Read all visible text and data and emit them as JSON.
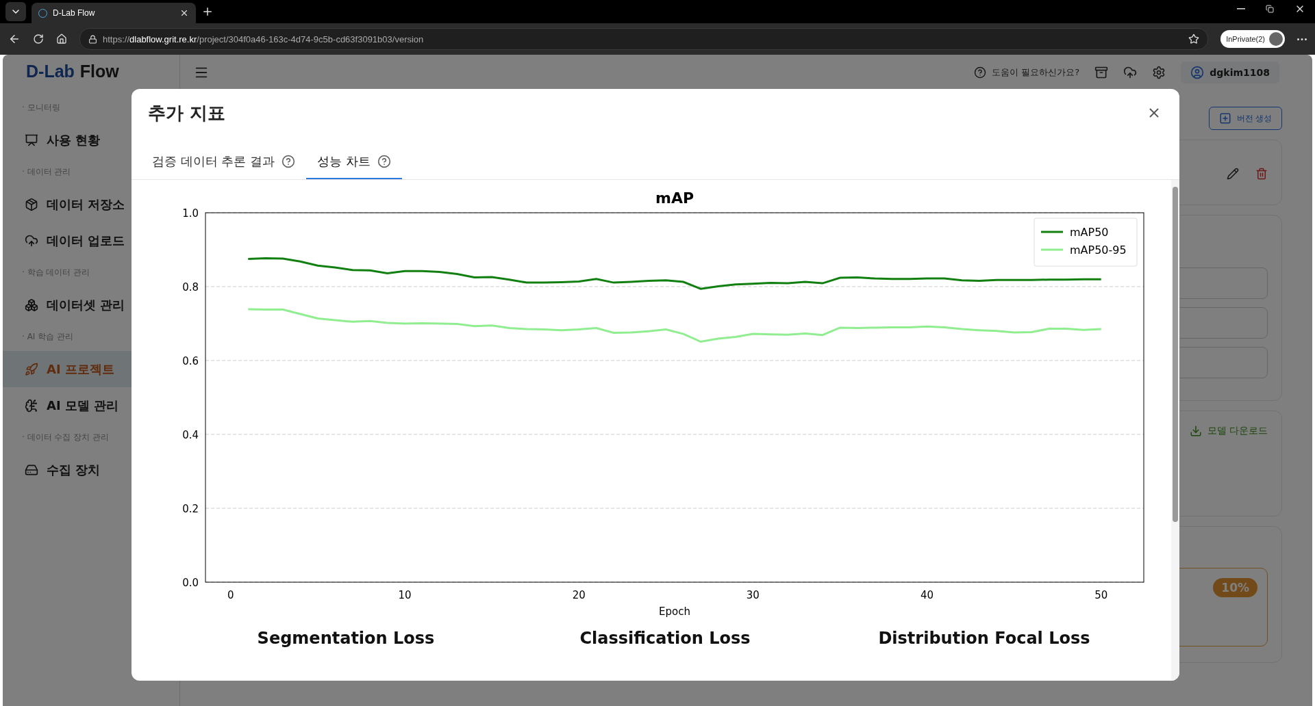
{
  "browser": {
    "tab_title": "D-Lab Flow",
    "url_scheme": "https://",
    "url_host": "dlabflow.grit.re.kr",
    "url_path": "/project/304f0a46-163c-4d74-9c5b-cd63f3091b03/version",
    "profile": "InPrivate(2)"
  },
  "app": {
    "logo_part1": "D-Lab",
    "logo_part2": "Flow",
    "help": "도움이 필요하신가요?",
    "user": "dgkim1108"
  },
  "sidebar": [
    {
      "label": "· 모니터링",
      "items": [
        {
          "label": "사용 현황",
          "selected": false
        }
      ]
    },
    {
      "label": "· 데이터 관리",
      "items": [
        {
          "label": "데이터 저장소",
          "selected": false
        },
        {
          "label": "데이터 업로드",
          "selected": false
        }
      ]
    },
    {
      "label": "· 학습 데이터 관리",
      "items": [
        {
          "label": "데이터셋 관리",
          "selected": false
        }
      ]
    },
    {
      "label": "· AI 학습 관리",
      "items": [
        {
          "label": "AI 프로젝트",
          "selected": true
        },
        {
          "label": "AI 모델 관리",
          "selected": false
        }
      ]
    },
    {
      "label": "· 데이터 수집 장치 관리",
      "items": [
        {
          "label": "수집 장치",
          "selected": false
        }
      ]
    }
  ],
  "background": {
    "create_button": "버전 생성",
    "download_link": "모델 다운로드",
    "progress_badge": "10%"
  },
  "modal": {
    "title": "추가 지표",
    "tabs": [
      {
        "label": "검증 데이터 추론 결과",
        "selected": false
      },
      {
        "label": "성능 차트",
        "selected": true
      }
    ],
    "chart_data": {
      "type": "line",
      "grid": true,
      "legend": true,
      "title": "mAP",
      "xlabel": "Epoch",
      "xlim": [
        -1.45,
        52.45
      ],
      "ylim": [
        0,
        1
      ],
      "xticks": [
        0,
        10,
        20,
        30,
        40,
        50
      ],
      "yticks": [
        {
          "value": 0,
          "label": "0.0"
        },
        {
          "value": 0.2,
          "label": "0.2"
        },
        {
          "value": 0.4,
          "label": "0.4"
        },
        {
          "value": 0.6,
          "label": "0.6"
        },
        {
          "value": 0.8,
          "label": "0.8"
        },
        {
          "value": 1,
          "label": "1.0"
        }
      ],
      "x": [
        1,
        2,
        3,
        4,
        5,
        6,
        7,
        8,
        9,
        10,
        11,
        12,
        13,
        14,
        15,
        16,
        17,
        18,
        19,
        20,
        21,
        22,
        23,
        24,
        25,
        26,
        27,
        28,
        29,
        30,
        31,
        32,
        33,
        34,
        35,
        36,
        37,
        38,
        39,
        40,
        41,
        42,
        43,
        44,
        45,
        46,
        47,
        48,
        49,
        50
      ],
      "series": [
        {
          "name": "mAP50",
          "color": "#118011",
          "values": [
            0.875,
            0.877,
            0.876,
            0.868,
            0.857,
            0.852,
            0.845,
            0.844,
            0.836,
            0.842,
            0.842,
            0.84,
            0.834,
            0.825,
            0.826,
            0.819,
            0.811,
            0.811,
            0.812,
            0.814,
            0.821,
            0.811,
            0.813,
            0.816,
            0.817,
            0.813,
            0.794,
            0.801,
            0.806,
            0.808,
            0.81,
            0.809,
            0.813,
            0.809,
            0.824,
            0.825,
            0.822,
            0.821,
            0.821,
            0.822,
            0.822,
            0.817,
            0.816,
            0.818,
            0.818,
            0.818,
            0.819,
            0.819,
            0.82,
            0.82
          ]
        },
        {
          "name": "mAP50-95",
          "color": "#90ee90",
          "values": [
            0.739,
            0.738,
            0.738,
            0.726,
            0.714,
            0.709,
            0.705,
            0.707,
            0.702,
            0.7,
            0.701,
            0.7,
            0.699,
            0.693,
            0.695,
            0.688,
            0.685,
            0.684,
            0.682,
            0.684,
            0.688,
            0.675,
            0.676,
            0.679,
            0.684,
            0.672,
            0.651,
            0.659,
            0.664,
            0.672,
            0.671,
            0.67,
            0.673,
            0.669,
            0.689,
            0.688,
            0.689,
            0.69,
            0.69,
            0.692,
            0.69,
            0.685,
            0.682,
            0.68,
            0.676,
            0.677,
            0.686,
            0.686,
            0.683,
            0.685
          ]
        }
      ]
    },
    "next_chart_titles": [
      "Segmentation Loss",
      "Classification Loss",
      "Distribution Focal Loss"
    ]
  }
}
